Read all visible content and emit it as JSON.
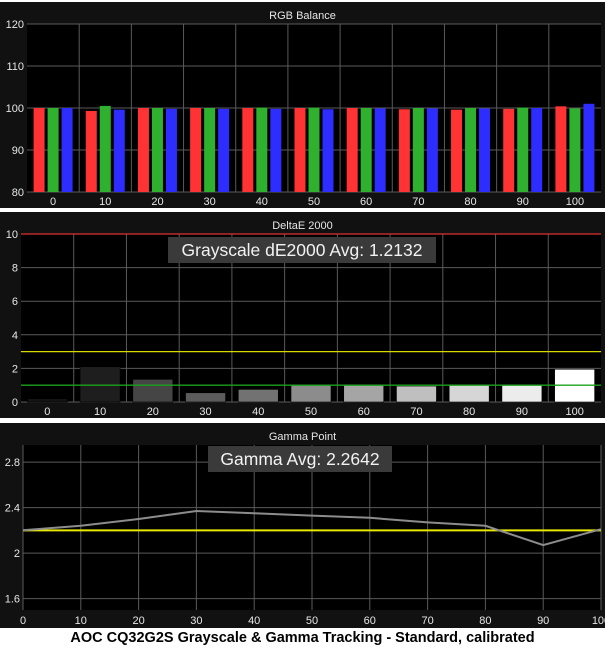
{
  "caption": "AOC CQ32G2S Grayscale & Gamma Tracking - Standard, calibrated",
  "colors": {
    "panel_bg": "#111111",
    "plot_bg": "#000000",
    "grid": "#5a5a5a",
    "text": "#e6e6e6",
    "red": "#ff3333",
    "green": "#2fb02f",
    "blue": "#2d2dff",
    "threshold_red": "#e03030",
    "threshold_yellow": "#d8d800",
    "threshold_green": "#1ea01e",
    "gamma_line": "#8c8c8c",
    "gamma_target": "#e8e800",
    "annotation_bg": "#3a3a3a",
    "annotation_text": "#f2f2f2"
  },
  "chart_data": [
    {
      "type": "bar",
      "title": "RGB Balance",
      "categories": [
        "0",
        "10",
        "20",
        "30",
        "40",
        "50",
        "60",
        "70",
        "80",
        "90",
        "100"
      ],
      "series": [
        {
          "name": "Red",
          "color_key": "red",
          "values": [
            100,
            99.3,
            100,
            100,
            100,
            100,
            100,
            99.7,
            99.6,
            99.8,
            100.4
          ]
        },
        {
          "name": "Green",
          "color_key": "green",
          "values": [
            100,
            100.5,
            100,
            100,
            100.1,
            100.1,
            100,
            100,
            100,
            100.1,
            99.9
          ]
        },
        {
          "name": "Blue",
          "color_key": "blue",
          "values": [
            100,
            99.6,
            99.8,
            99.8,
            99.8,
            99.7,
            99.9,
            99.9,
            99.9,
            100,
            101
          ]
        }
      ],
      "ylim": [
        80,
        120
      ],
      "yticks": [
        80,
        90,
        100,
        110,
        120
      ],
      "grid": true
    },
    {
      "type": "bar",
      "title": "DeltaE 2000",
      "annotation": "Grayscale dE2000 Avg: 1.2132",
      "categories": [
        "0",
        "10",
        "20",
        "30",
        "40",
        "50",
        "60",
        "70",
        "80",
        "90",
        "100"
      ],
      "values": [
        0.2,
        2.1,
        1.35,
        0.55,
        0.75,
        1.0,
        1.05,
        0.95,
        1.05,
        1.05,
        1.95
      ],
      "bar_colors": [
        "#141414",
        "#1e1e1e",
        "#454545",
        "#5c5c5c",
        "#727272",
        "#8c8c8c",
        "#a5a5a5",
        "#bfbfbf",
        "#d6d6d6",
        "#ececec",
        "#ffffff"
      ],
      "thresholds": [
        {
          "value": 10,
          "color_key": "threshold_red"
        },
        {
          "value": 3,
          "color_key": "threshold_yellow"
        },
        {
          "value": 1,
          "color_key": "threshold_green"
        }
      ],
      "ylim": [
        0,
        10
      ],
      "yticks": [
        0,
        2,
        4,
        6,
        8,
        10
      ],
      "grid": true
    },
    {
      "type": "line",
      "title": "Gamma Point",
      "annotation": "Gamma Avg: 2.2642",
      "x": [
        0,
        10,
        20,
        30,
        40,
        50,
        60,
        70,
        80,
        90,
        100
      ],
      "y": [
        2.2,
        2.24,
        2.3,
        2.37,
        2.35,
        2.33,
        2.31,
        2.27,
        2.24,
        2.07,
        2.21
      ],
      "target": 2.2,
      "xlim": [
        0,
        100
      ],
      "ylim": [
        1.5,
        2.95
      ],
      "xticks": [
        0,
        10,
        20,
        30,
        40,
        50,
        60,
        70,
        80,
        90,
        100
      ],
      "yticks": [
        1.6,
        2,
        2.4,
        2.8
      ],
      "grid": true
    }
  ]
}
